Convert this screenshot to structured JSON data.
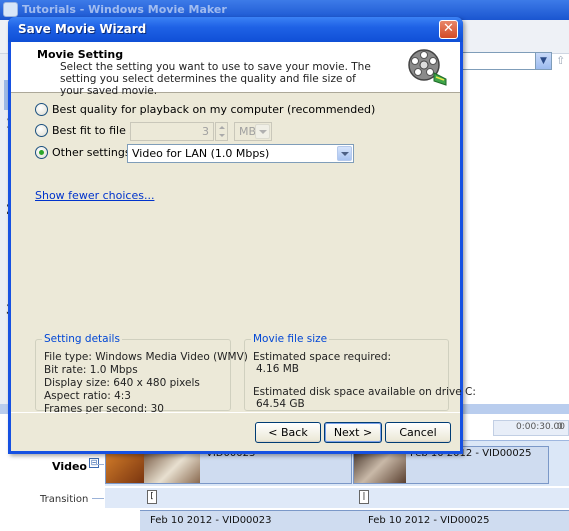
{
  "background_app": {
    "title": "Tutorials - Windows Movie Maker",
    "step_numbers": [
      "1",
      "2",
      "3"
    ],
    "timeline": {
      "ruler_labels": [
        "0:00:30.00",
        "0"
      ],
      "track_video_label": "Video",
      "expand_symbol": "⊟",
      "track_transition_label": "Transition",
      "clips": [
        {
          "name": "VID00023"
        },
        {
          "name": "Feb 10 2012 - VID00025"
        }
      ],
      "transition_marks": [
        "[",
        "|"
      ],
      "audio_clips": [
        {
          "name": "Feb 10 2012 - VID00023"
        },
        {
          "name": "Feb 10 2012 - VID00025"
        }
      ]
    }
  },
  "dialog": {
    "title": "Save Movie Wizard",
    "close_symbol": "✕",
    "header": {
      "title": "Movie Setting",
      "description": "Select the setting you want to use to save your movie. The setting you select determines the quality and file size of your saved movie."
    },
    "options": {
      "best_quality": {
        "label": "Best quality for playback on my computer (recommended)",
        "selected": false
      },
      "best_fit": {
        "label": "Best fit to file size:",
        "selected": false,
        "size_value": "3",
        "unit": "MB"
      },
      "other": {
        "label": "Other settings:",
        "selected": true,
        "value": "Video for LAN (1.0 Mbps)"
      }
    },
    "show_fewer_link": "Show fewer choices...",
    "setting_details": {
      "legend": "Setting details",
      "lines": [
        "File type: Windows Media Video (WMV)",
        "Bit rate: 1.0 Mbps",
        "Display size: 640 x 480 pixels",
        "Aspect ratio: 4:3",
        "Frames per second: 30"
      ]
    },
    "movie_file_size": {
      "legend": "Movie file size",
      "space_required_label": "Estimated space required:",
      "space_required_value": "4.16 MB",
      "disk_space_label": "Estimated disk space available on drive C:",
      "disk_space_value": "64.54 GB"
    },
    "buttons": {
      "back": "< Back",
      "next": "Next >",
      "cancel": "Cancel"
    }
  },
  "colors": {
    "dialog_frame": "#1651e2",
    "dialog_face": "#ece9d8",
    "link": "#0033cc",
    "group_legend": "#0046d5",
    "close_button": "#d34a26"
  }
}
